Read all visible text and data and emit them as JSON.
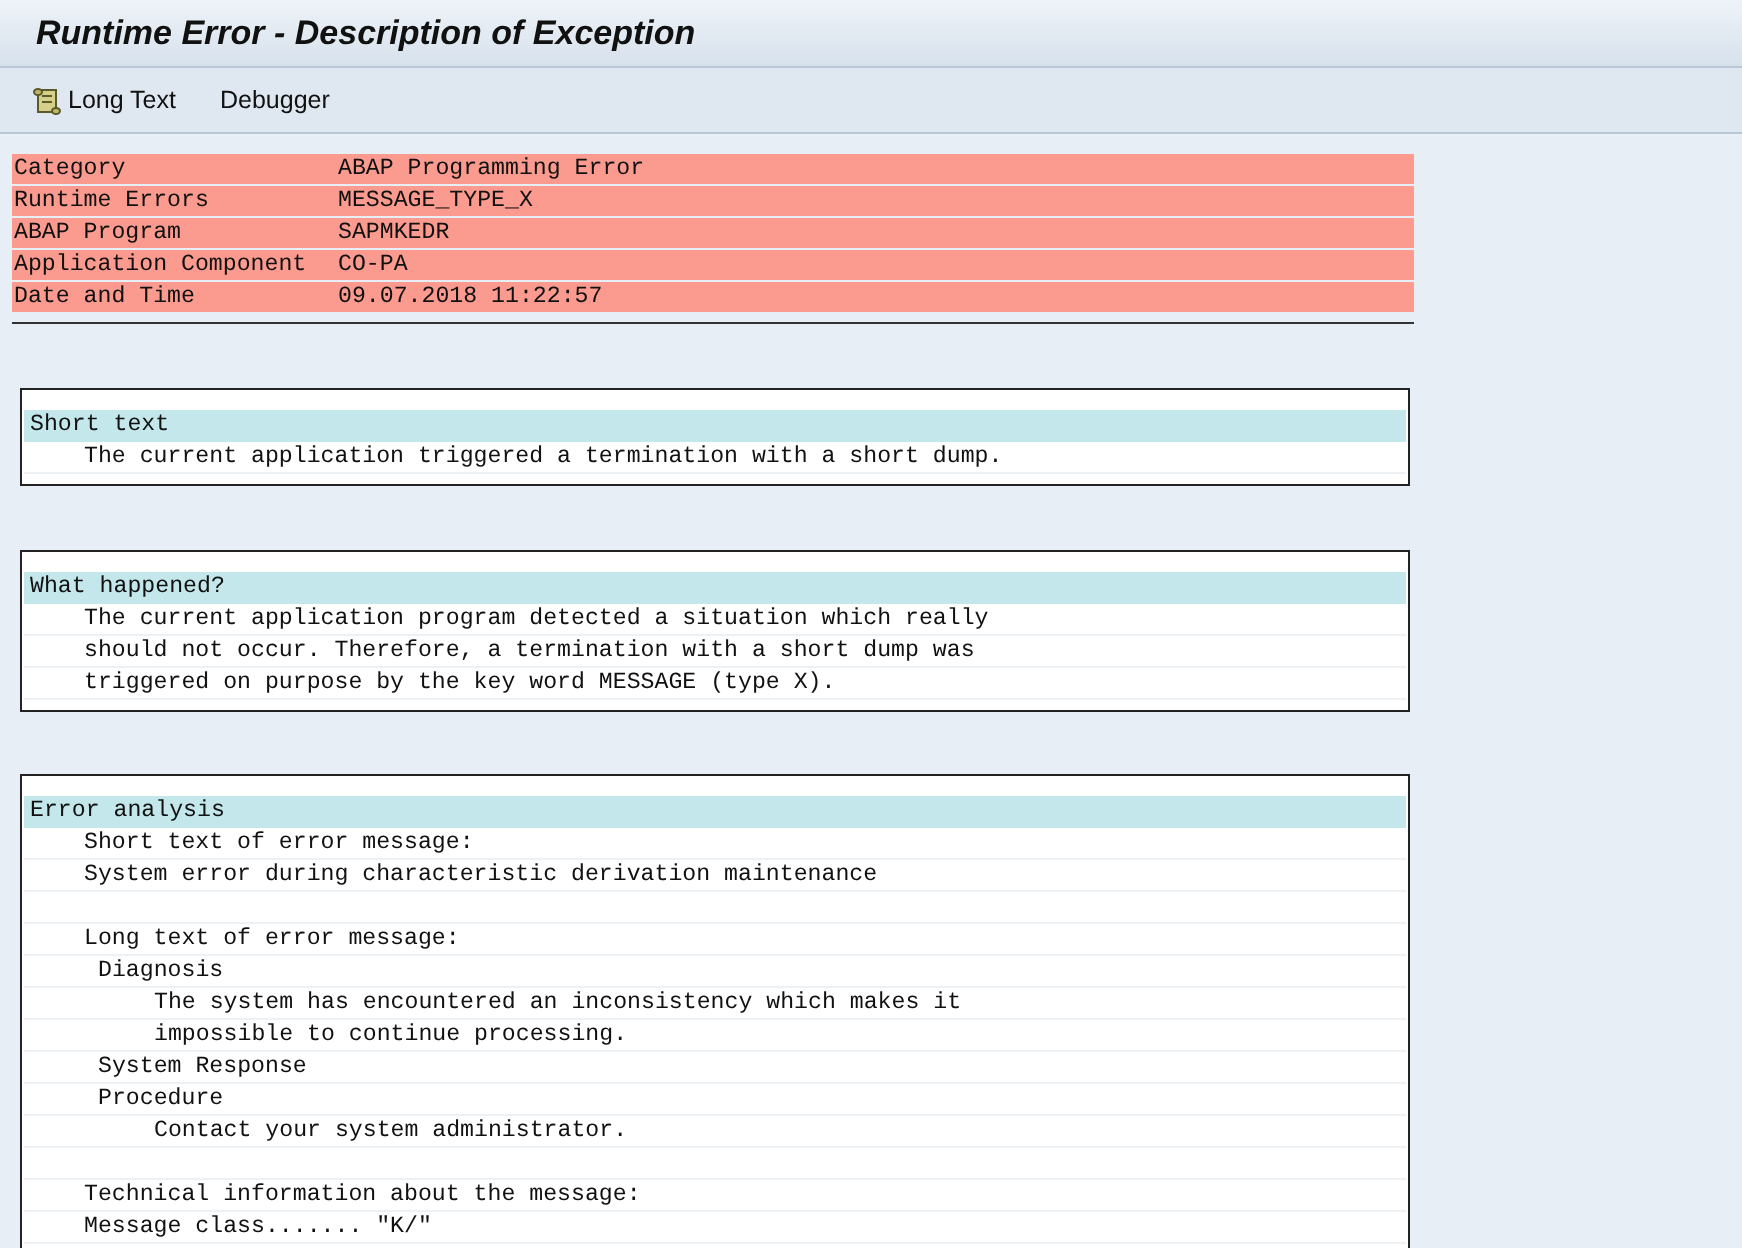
{
  "window": {
    "title": "Runtime Error - Description of Exception"
  },
  "toolbar": [
    {
      "kind": "icon",
      "label": "Long Text"
    },
    {
      "kind": "plain",
      "label": "Debugger"
    }
  ],
  "header": [
    {
      "label": "Category",
      "value": "ABAP Programming Error"
    },
    {
      "label": "Runtime Errors",
      "value": "MESSAGE_TYPE_X"
    },
    {
      "label": "ABAP Program",
      "value": "SAPMKEDR"
    },
    {
      "label": "Application Component",
      "value": "CO-PA"
    },
    {
      "label": "Date and Time",
      "value": "09.07.2018 11:22:57"
    }
  ],
  "sections": [
    {
      "title": "Short text",
      "lines": [
        {
          "kind": "text",
          "text": "The current application triggered a termination with a short dump."
        }
      ]
    },
    {
      "title": "What happened?",
      "lines": [
        {
          "kind": "text",
          "text": "The current application program detected a situation which really"
        },
        {
          "kind": "text",
          "text": "should not occur. Therefore, a termination with a short dump was"
        },
        {
          "kind": "text",
          "text": "triggered on purpose by the key word MESSAGE (type X)."
        }
      ]
    },
    {
      "title": "Error analysis",
      "lines": [
        {
          "kind": "text",
          "text": "Short text of error message:"
        },
        {
          "kind": "text",
          "text": "System error during characteristic derivation maintenance"
        },
        {
          "kind": "blank"
        },
        {
          "kind": "text",
          "text": "Long text of error message:",
          "children": [
            {
              "kind": "text",
              "text": "Diagnosis",
              "children": [
                {
                  "kind": "text",
                  "text": "The system has encountered an inconsistency which makes it"
                },
                {
                  "kind": "text",
                  "text": "impossible to continue processing."
                }
              ]
            },
            {
              "kind": "text",
              "text": "System Response"
            },
            {
              "kind": "text",
              "text": "Procedure",
              "children": [
                {
                  "kind": "text",
                  "text": "Contact your system administrator."
                }
              ]
            }
          ]
        },
        {
          "kind": "blank"
        },
        {
          "kind": "text",
          "text": "Technical information about the message:"
        },
        {
          "kind": "text",
          "text": "Message class....... \"K/\""
        }
      ]
    }
  ]
}
